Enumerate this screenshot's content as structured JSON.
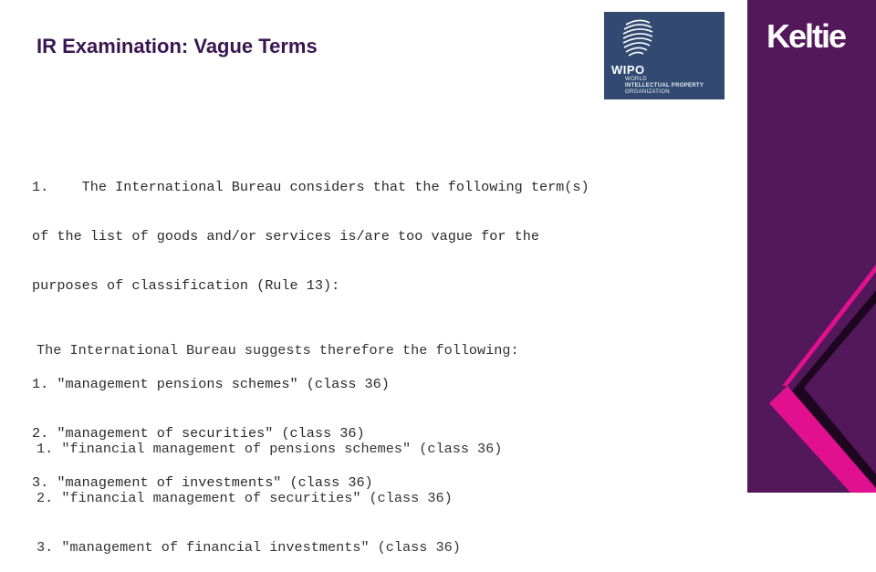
{
  "slide": {
    "title": "IR Examination: Vague Terms"
  },
  "logos": {
    "wipo": {
      "acronym": "WIPO",
      "line1": "WORLD",
      "line2": "INTELLECTUAL PROPERTY",
      "line3": "ORGANIZATION",
      "background": "#324a72"
    },
    "keltie": {
      "wordmark": "Keltie",
      "panel_color": "#53185a",
      "accent_color": "#e0108e",
      "shadow_color": "#1e0520"
    }
  },
  "irregularity_notice": {
    "intro_lines": [
      "1.    The International Bureau considers that the following term(s)",
      "of the list of goods and/or services is/are too vague for the",
      "purposes of classification (Rule 13):"
    ],
    "items": [
      "1. \"management pensions schemes\" (class 36)",
      "2. \"management of securities\" (class 36)",
      "3. \"management of investments\" (class 36)"
    ]
  },
  "suggestions": {
    "intro": "The International Bureau suggests therefore the following:",
    "items": [
      "1. \"financial management of pensions schemes\" (class 36)",
      "2. \"financial management of securities\" (class 36)",
      "3. \"management of financial investments\" (class 36)"
    ]
  }
}
